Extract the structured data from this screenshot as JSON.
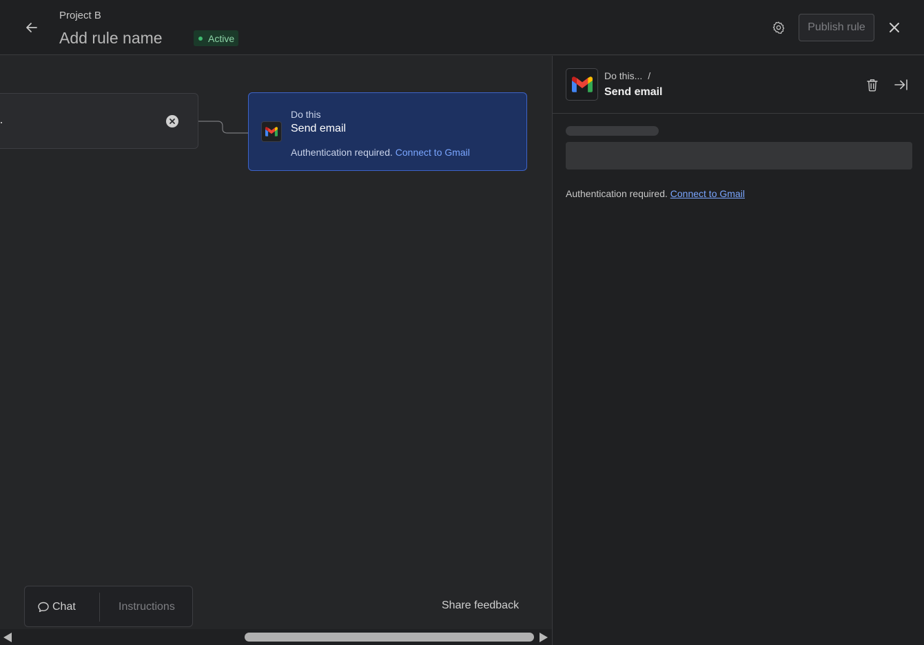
{
  "header": {
    "project_name": "Project B",
    "rule_title": "Add rule name",
    "status": "Active",
    "publish_label": "Publish rule"
  },
  "canvas": {
    "action_card": {
      "label": "Do this",
      "title": "Send email",
      "auth_text": "Authentication required.",
      "auth_link": "Connect to Gmail"
    },
    "bottom_bar": {
      "chat_label": "Chat",
      "instructions_label": "Instructions"
    },
    "share_feedback": "Share feedback"
  },
  "side_panel": {
    "breadcrumb": "Do this...",
    "breadcrumb_sep": "/",
    "title": "Send email",
    "auth_text": "Authentication required.",
    "auth_link": "Connect to Gmail"
  },
  "colors": {
    "accent_link": "#7aa6ff",
    "card_selected": "#1d3161",
    "status_green": "#3fb96f"
  },
  "icons": [
    "arrow-left-icon",
    "gear-icon",
    "close-icon",
    "gmail-icon",
    "trash-icon",
    "collapse-right-icon",
    "chat-bubble-icon",
    "clear-icon"
  ]
}
